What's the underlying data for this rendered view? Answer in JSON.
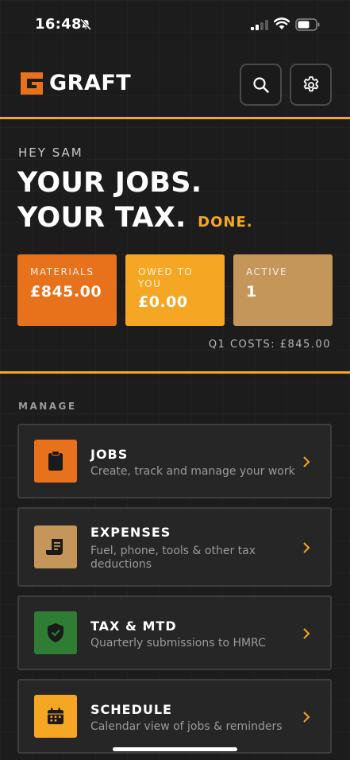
{
  "status_bar": {
    "time": "16:48"
  },
  "header": {
    "logo_text": "GRAFT"
  },
  "hero": {
    "greeting": "HEY SAM",
    "headline_line1": "YOUR JOBS.",
    "headline_line2": "YOUR TAX.",
    "headline_accent": "DONE."
  },
  "stats": [
    {
      "label": "MATERIALS",
      "value": "£845.00",
      "color": "#e8721c"
    },
    {
      "label": "OWED TO YOU",
      "value": "£0.00",
      "color": "#f5a623"
    },
    {
      "label": "ACTIVE",
      "value": "1",
      "color": "#c4965a"
    }
  ],
  "q1_costs": "Q1 COSTS: £845.00",
  "manage": {
    "title": "MANAGE",
    "items": [
      {
        "title": "JOBS",
        "subtitle": "Create, track and manage your work",
        "icon": "clipboard-icon",
        "color": "#e8721c"
      },
      {
        "title": "EXPENSES",
        "subtitle": "Fuel, phone, tools & other tax deductions",
        "icon": "receipt-icon",
        "color": "#c4965a"
      },
      {
        "title": "TAX & MTD",
        "subtitle": "Quarterly submissions to HMRC",
        "icon": "shield-check-icon",
        "color": "#2e7d32"
      },
      {
        "title": "SCHEDULE",
        "subtitle": "Calendar view of jobs & reminders",
        "icon": "calendar-icon",
        "color": "#f5a623"
      }
    ]
  },
  "colors": {
    "accent": "#f5a623",
    "background": "#1c1c1c"
  }
}
